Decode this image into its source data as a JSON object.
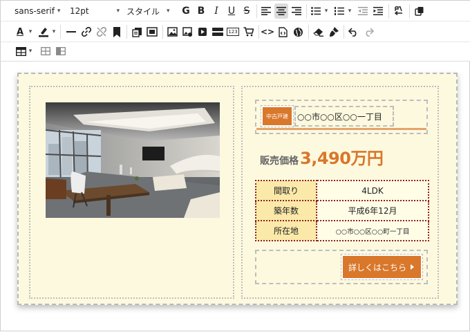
{
  "toolbar": {
    "font_family": "sans-serif",
    "font_size": "12pt",
    "style_label": "スタイル",
    "bold_g_label": "G",
    "bold_label": "B",
    "italic_label": "I",
    "underline_label": "U",
    "strike_label": "S",
    "font_color_label": "A",
    "code_label": "<>",
    "counter_label": "123",
    "active_color": "#dcdcdc"
  },
  "listing": {
    "tag": "中古戸建",
    "address_head": "○○市○○区○○一丁目",
    "price_label": "販売価格",
    "price_value": "3,490万円",
    "specs": [
      {
        "key": "間取り",
        "value": "4LDK"
      },
      {
        "key": "築年数",
        "value": "平成6年12月"
      },
      {
        "key": "所在地",
        "value": "○○市○○区○○町一丁目"
      }
    ],
    "detail_button": "詳しくはこちら",
    "accent_color": "#d9772b",
    "card_bg": "#fdf9df"
  }
}
